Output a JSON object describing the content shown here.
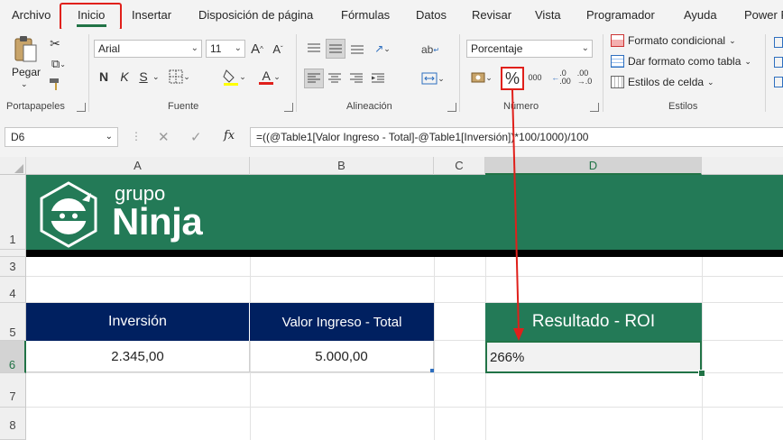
{
  "menu": {
    "items": [
      "Archivo",
      "Inicio",
      "Insertar",
      "Disposición de página",
      "Fórmulas",
      "Datos",
      "Revisar",
      "Vista",
      "Programador",
      "Ayuda",
      "Power P"
    ]
  },
  "ribbon": {
    "clipboard": {
      "paste_label": "Pegar",
      "group_label": "Portapapeles"
    },
    "font": {
      "font_name": "Arial",
      "font_size": "11",
      "bold": "N",
      "italic": "K",
      "underline": "S",
      "group_label": "Fuente"
    },
    "alignment": {
      "group_label": "Alineación"
    },
    "number": {
      "format": "Porcentaje",
      "percent": "%",
      "thousands": "000",
      "group_label": "Número"
    },
    "styles": {
      "conditional": "Formato condicional",
      "as_table": "Dar formato como tabla",
      "cell_styles": "Estilos de celda",
      "group_label": "Estilos"
    }
  },
  "formula_bar": {
    "name_box": "D6",
    "fx": "fx",
    "formula": "=((@Table1[Valor Ingreso - Total]-@Table1[Inversión])*100/1000)/100"
  },
  "grid": {
    "columns": [
      "A",
      "B",
      "C",
      "D"
    ],
    "rows": [
      "1",
      "3",
      "4",
      "5",
      "6",
      "7",
      "8"
    ],
    "logo_top": "grupo",
    "logo_bottom": "Ninja",
    "table": {
      "header_inversion": "Inversión",
      "header_valor": "Valor Ingreso - Total",
      "value_inversion": "2.345,00",
      "value_valor": "5.000,00"
    },
    "result": {
      "header": "Resultado - ROI",
      "value": "266%"
    }
  },
  "colors": {
    "excel_green": "#217346",
    "banner_green": "#237a57",
    "navy": "#002060",
    "highlight_red": "#e0201b"
  }
}
